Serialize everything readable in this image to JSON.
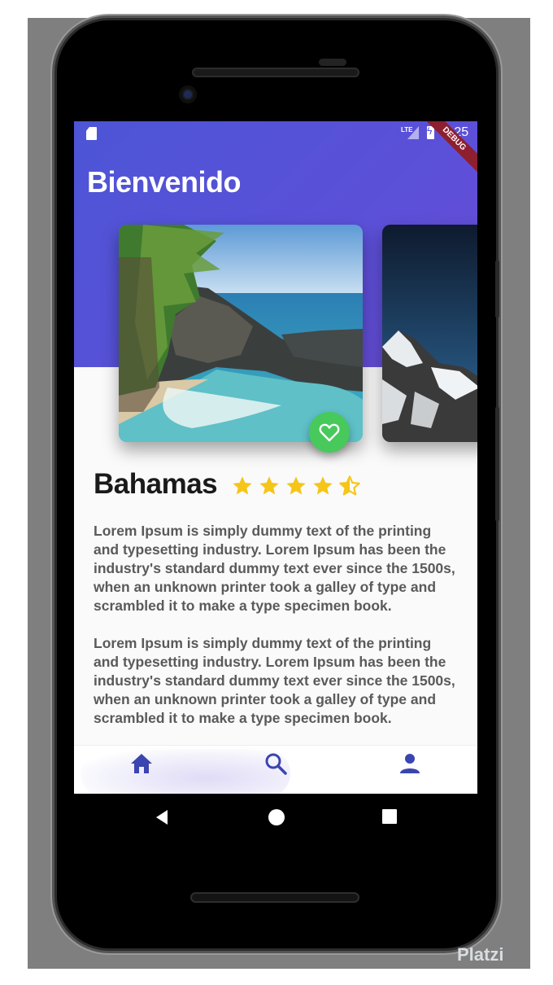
{
  "status_bar": {
    "network": "LTE",
    "time": "6:25",
    "debug_banner": "DEBUG"
  },
  "header": {
    "title": "Bienvenido"
  },
  "place": {
    "name": "Bahamas",
    "rating": 4.5,
    "rating_max": 5
  },
  "description": {
    "paragraphs": [
      "Lorem Ipsum is simply dummy text of the printing and typesetting industry. Lorem Ipsum has been the industry's standard dummy text ever since the 1500s, when an unknown printer took a galley of type and scrambled it to make a type specimen book.",
      "Lorem Ipsum is simply dummy text of the printing and typesetting industry. Lorem Ipsum has been the industry's standard dummy text ever since the 1500s, when an unknown printer took a galley of type and scrambled it to make a type specimen book."
    ]
  },
  "bottom_nav": {
    "items": [
      {
        "icon": "home-icon",
        "active": true
      },
      {
        "icon": "search-icon",
        "active": false
      },
      {
        "icon": "person-icon",
        "active": false
      }
    ]
  },
  "colors": {
    "header_gradient_start": "#4d55d6",
    "header_gradient_end": "#6a4bd6",
    "favorite_button": "#47c95c",
    "star": "#f5c518",
    "nav_icon": "#3a45b0",
    "debug_ribbon": "#8e1f2f"
  },
  "watermark": "Platzi"
}
